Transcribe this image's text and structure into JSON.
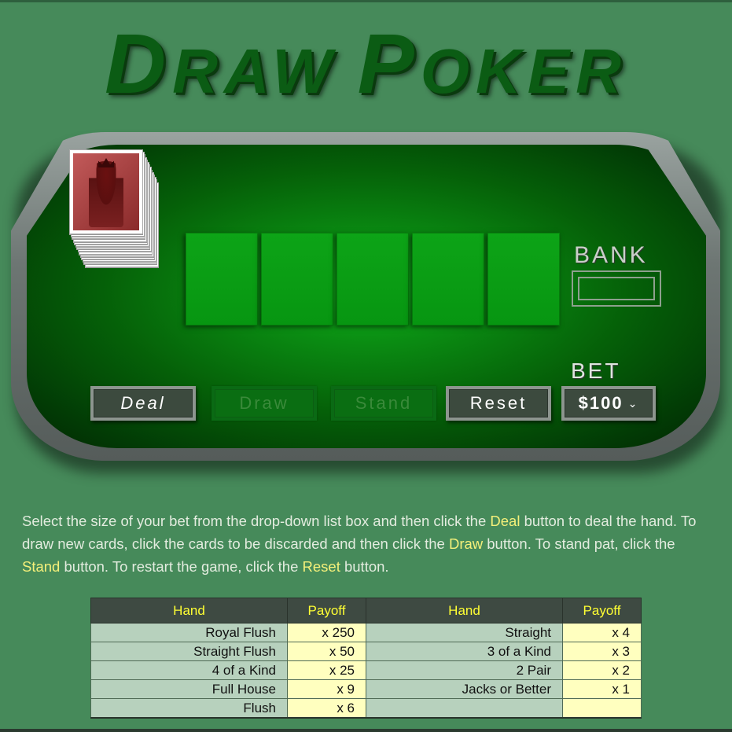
{
  "title": {
    "word1_cap": "D",
    "word1_rest": "RAW",
    "word2_cap": "P",
    "word2_rest": "OKER"
  },
  "table": {
    "bank_label": "BANK",
    "bank_value": "",
    "bet_label": "BET",
    "card_slots": 5
  },
  "buttons": {
    "deal": "Deal",
    "draw": "Draw",
    "stand": "Stand",
    "reset": "Reset"
  },
  "bet_select": {
    "selected": "$100",
    "icon": "chevron-down-icon"
  },
  "instructions": {
    "p1": "Select the size of your bet from the drop-down list box and then click the ",
    "deal": "Deal",
    "p2": " button to deal the hand. To draw new cards, click the cards to be discarded and then click the ",
    "draw": "Draw",
    "p3": " button. To stand pat, click the ",
    "stand": "Stand",
    "p4": " button. To restart the game, click the ",
    "reset": "Reset",
    "p5": " button."
  },
  "payoff_table": {
    "headers": [
      "Hand",
      "Payoff",
      "Hand",
      "Payoff"
    ],
    "rows": [
      [
        "Royal Flush",
        "x 250",
        "Straight",
        "x 4"
      ],
      [
        "Straight Flush",
        "x 50",
        "3 of a Kind",
        "x 3"
      ],
      [
        "4 of a Kind",
        "x 25",
        "2 Pair",
        "x 2"
      ],
      [
        "Full House",
        "x 9",
        "Jacks or Better",
        "x 1"
      ],
      [
        "Flush",
        "x 6",
        "",
        ""
      ]
    ]
  },
  "colors": {
    "background": "#468a5a",
    "felt": "#0a8a12",
    "highlight": "#f5f07a",
    "header_text": "#ffff33"
  }
}
